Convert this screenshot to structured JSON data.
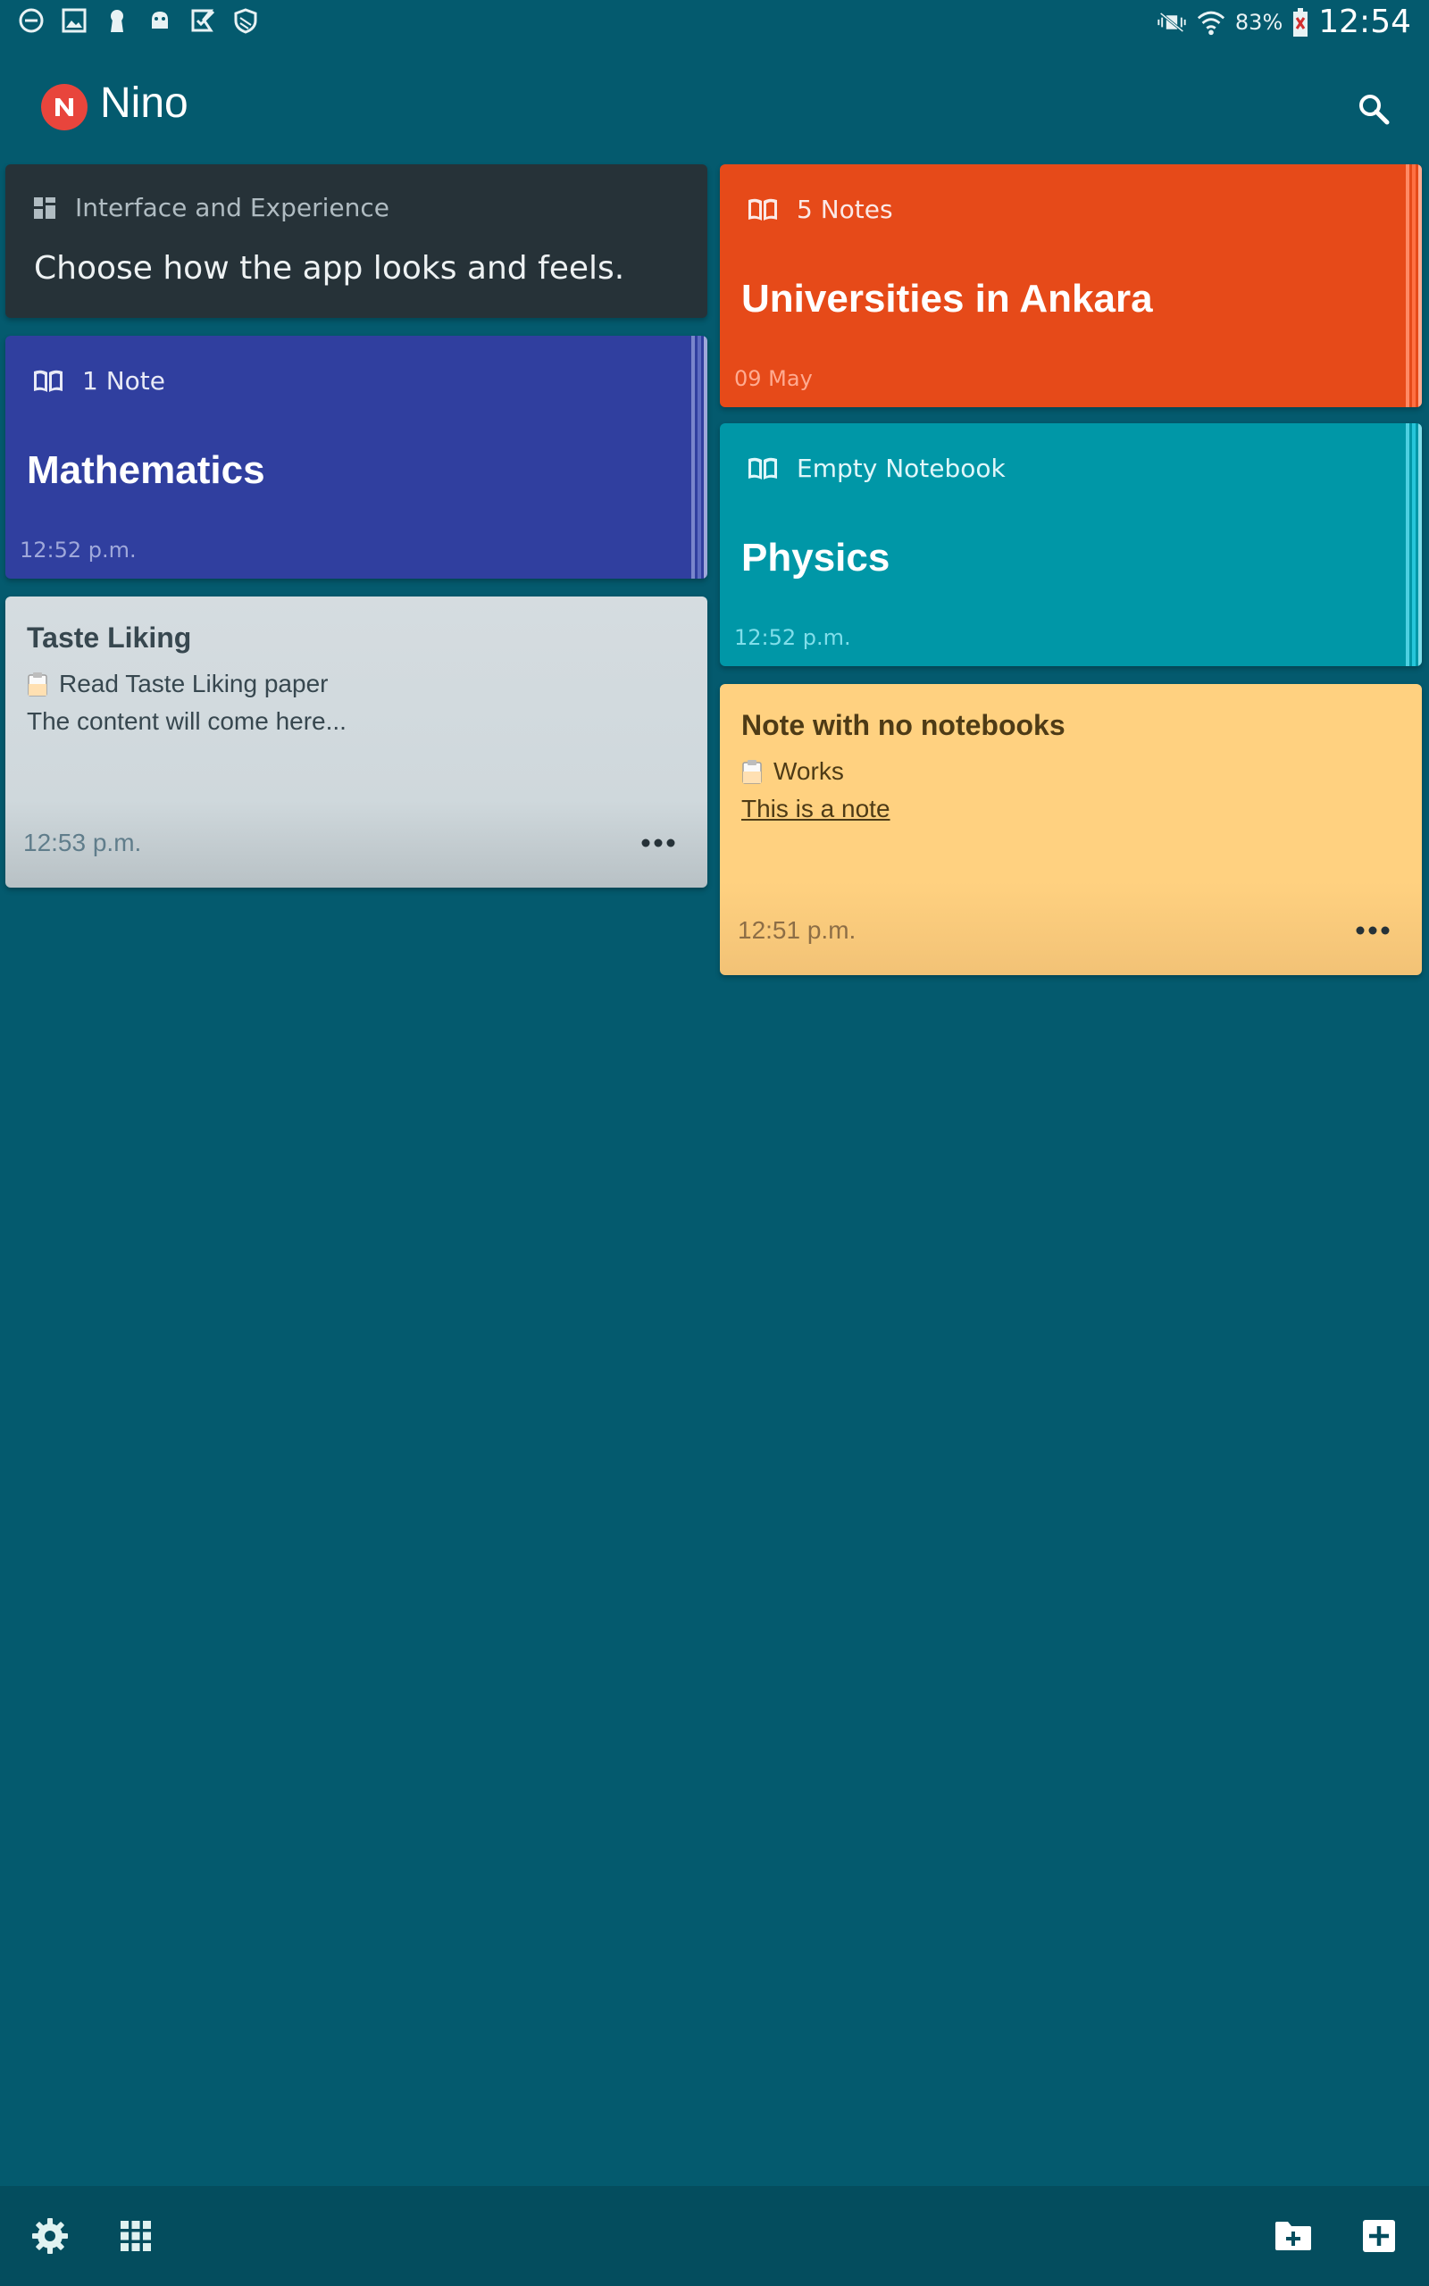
{
  "status_bar": {
    "battery": "83%",
    "time": "12:54"
  },
  "app": {
    "title": "Nino"
  },
  "cards": {
    "interface": {
      "category": "Interface and Experience",
      "text": "Choose how the app looks and feels."
    },
    "ankara": {
      "count": "5 Notes",
      "title": "Universities in Ankara",
      "date": "09 May",
      "color": "#e64a19"
    },
    "math": {
      "count": "1 Note",
      "title": "Mathematics",
      "date": "12:52 p.m.",
      "color": "#303f9f"
    },
    "physics": {
      "count": "Empty Notebook",
      "title": "Physics",
      "date": "12:52 p.m.",
      "color": "#0097a7"
    },
    "taste": {
      "title": "Taste Liking",
      "todo": "Read Taste Liking paper",
      "body": "The content will come here...",
      "time": "12:53 p.m."
    },
    "no_notebook": {
      "title": "Note with no notebooks",
      "todo": "Works",
      "body": "This is a note",
      "time": "12:51 p.m."
    }
  }
}
